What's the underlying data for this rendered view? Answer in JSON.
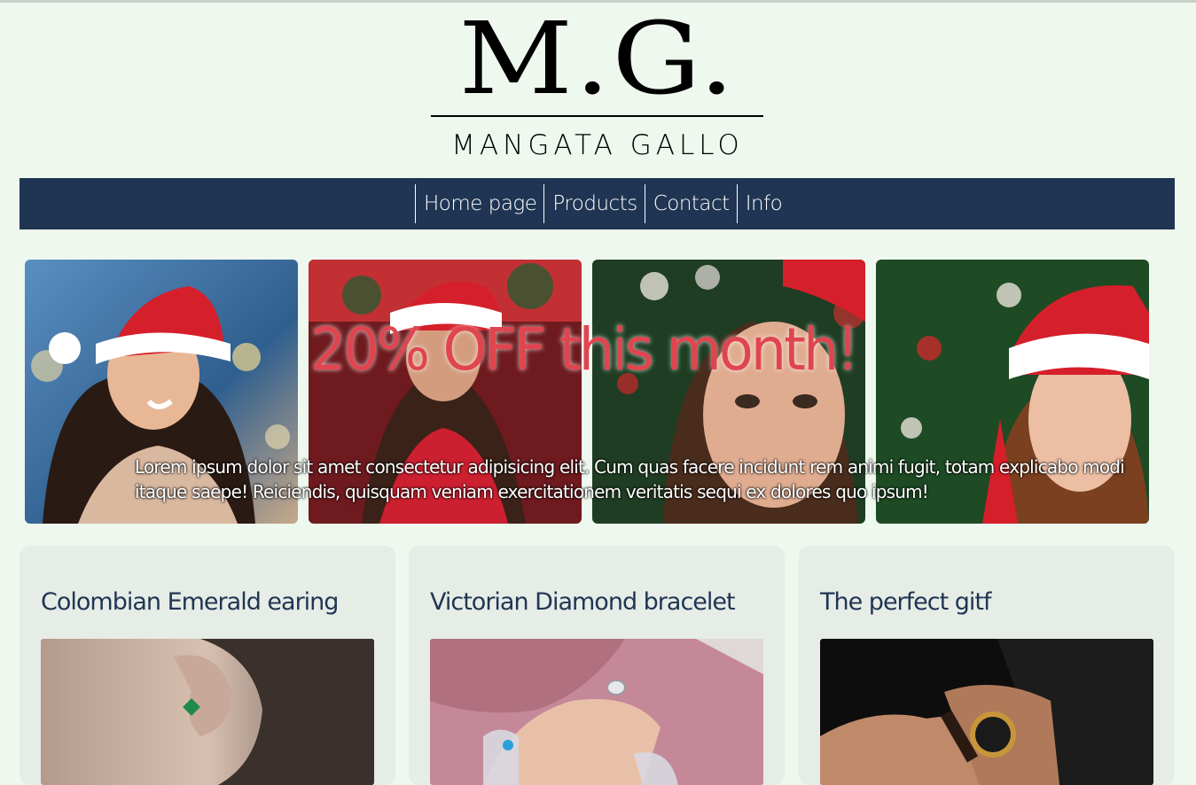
{
  "brand": {
    "mark": "M.G.",
    "name": "MANGATA GALLO"
  },
  "nav": {
    "items": [
      "Home page",
      "Products",
      "Contact",
      "Info"
    ]
  },
  "hero": {
    "headline": "20% OFF this month!",
    "body": "Lorem ipsum dolor sit amet consectetur adipisicing elit. Cum quas facere incidunt rem animi fugit, totam explicabo modi itaque saepe! Reiciendis, quisquam veniam exercitationem veritatis sequi ex dolores quo ipsum!",
    "image_icons": [
      "santa-hat-woman-photo",
      "santa-hat-woman-photo",
      "christmas-woman-photo",
      "santa-hat-woman-photo"
    ]
  },
  "products": [
    {
      "title": "Colombian Emerald earing",
      "image_icon": "emerald-earring-photo"
    },
    {
      "title": "Victorian Diamond bracelet",
      "image_icon": "diamond-bracelet-photo"
    },
    {
      "title": "The perfect gitf",
      "image_icon": "gold-watch-photo"
    }
  ],
  "colors": {
    "background": "#eef8ee",
    "navbar": "#1f3553",
    "headline": "#e0454f",
    "card": "#e6ece6",
    "card_title": "#1f3553"
  }
}
